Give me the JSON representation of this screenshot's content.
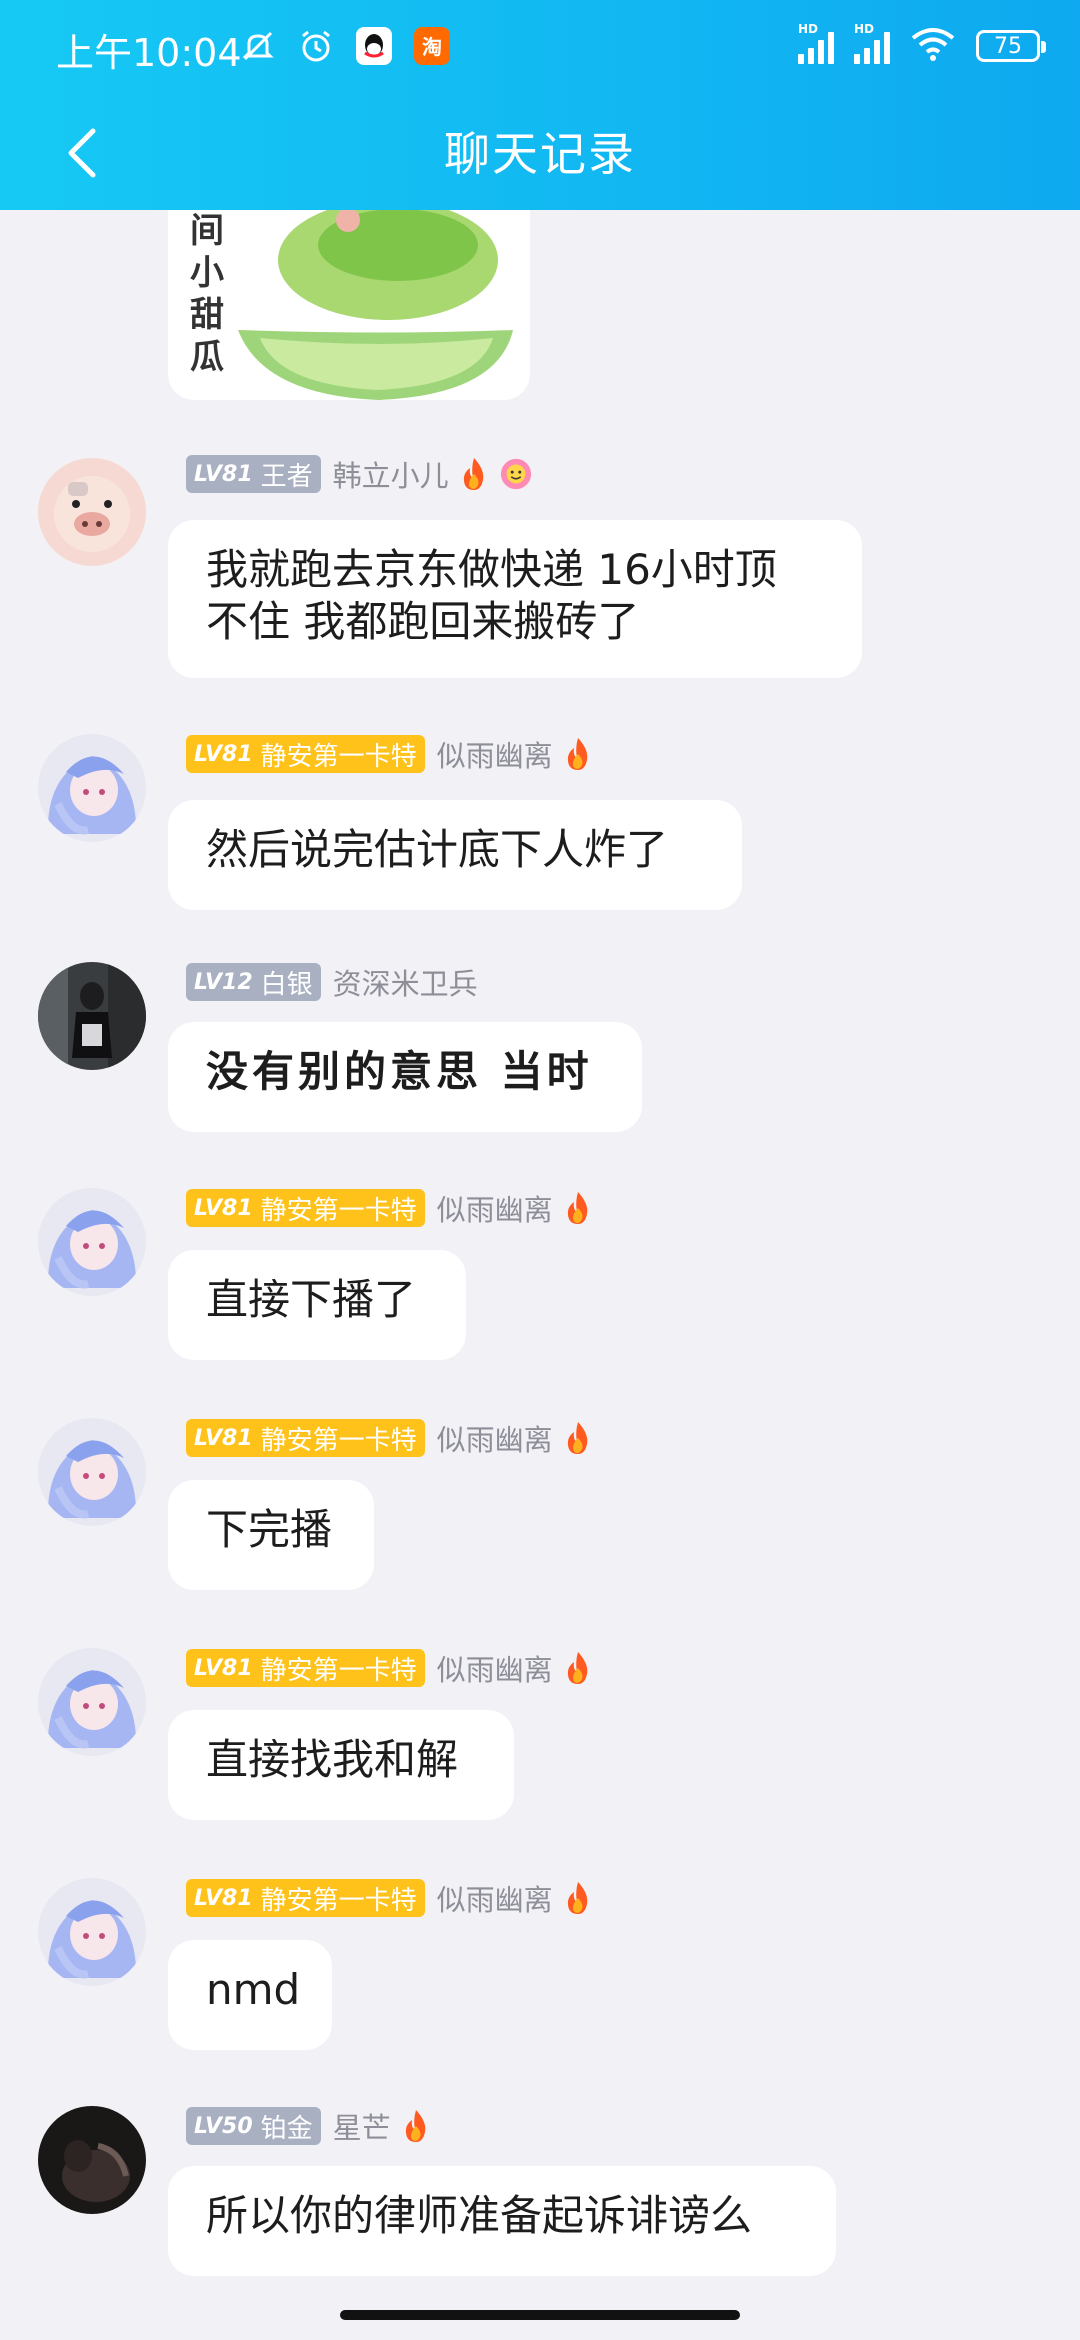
{
  "status_bar": {
    "time": "上午10:04",
    "battery": "75",
    "net1": "HD",
    "net2": "HD"
  },
  "nav": {
    "title": "聊天记录"
  },
  "sticker": {
    "text": [
      "间",
      "小",
      "甜",
      "瓜"
    ]
  },
  "messages": [
    {
      "level": "LV81",
      "title": "王者",
      "nick": "韩立小儿",
      "text": [
        "我就跑去京东做快递 16小时顶",
        "不住 我都跑回来搬砖了"
      ]
    },
    {
      "level": "LV81",
      "title": "静安第一卡特",
      "nick": "似雨幽离",
      "text": [
        "然后说完估计底下人炸了"
      ]
    },
    {
      "level": "LV12",
      "title": "白银",
      "nick": "资深米卫兵",
      "text": [
        "没有别的意思  当时"
      ]
    },
    {
      "level": "LV81",
      "title": "静安第一卡特",
      "nick": "似雨幽离",
      "text": [
        "直接下播了"
      ]
    },
    {
      "level": "LV81",
      "title": "静安第一卡特",
      "nick": "似雨幽离",
      "text": [
        "下完播"
      ]
    },
    {
      "level": "LV81",
      "title": "静安第一卡特",
      "nick": "似雨幽离",
      "text": [
        "直接找我和解"
      ]
    },
    {
      "level": "LV81",
      "title": "静安第一卡特",
      "nick": "似雨幽离",
      "text": [
        "nmd"
      ]
    },
    {
      "level": "LV50",
      "title": "铂金",
      "nick": "星芒",
      "text": [
        "所以你的律师准备起诉诽谤么"
      ]
    }
  ],
  "colors": {
    "header_start": "#16c9f4",
    "header_end": "#0ea9f0",
    "badge_gold": "#ffc21a",
    "badge_gray": "#a9b0c2",
    "background": "#f1f1f6"
  }
}
